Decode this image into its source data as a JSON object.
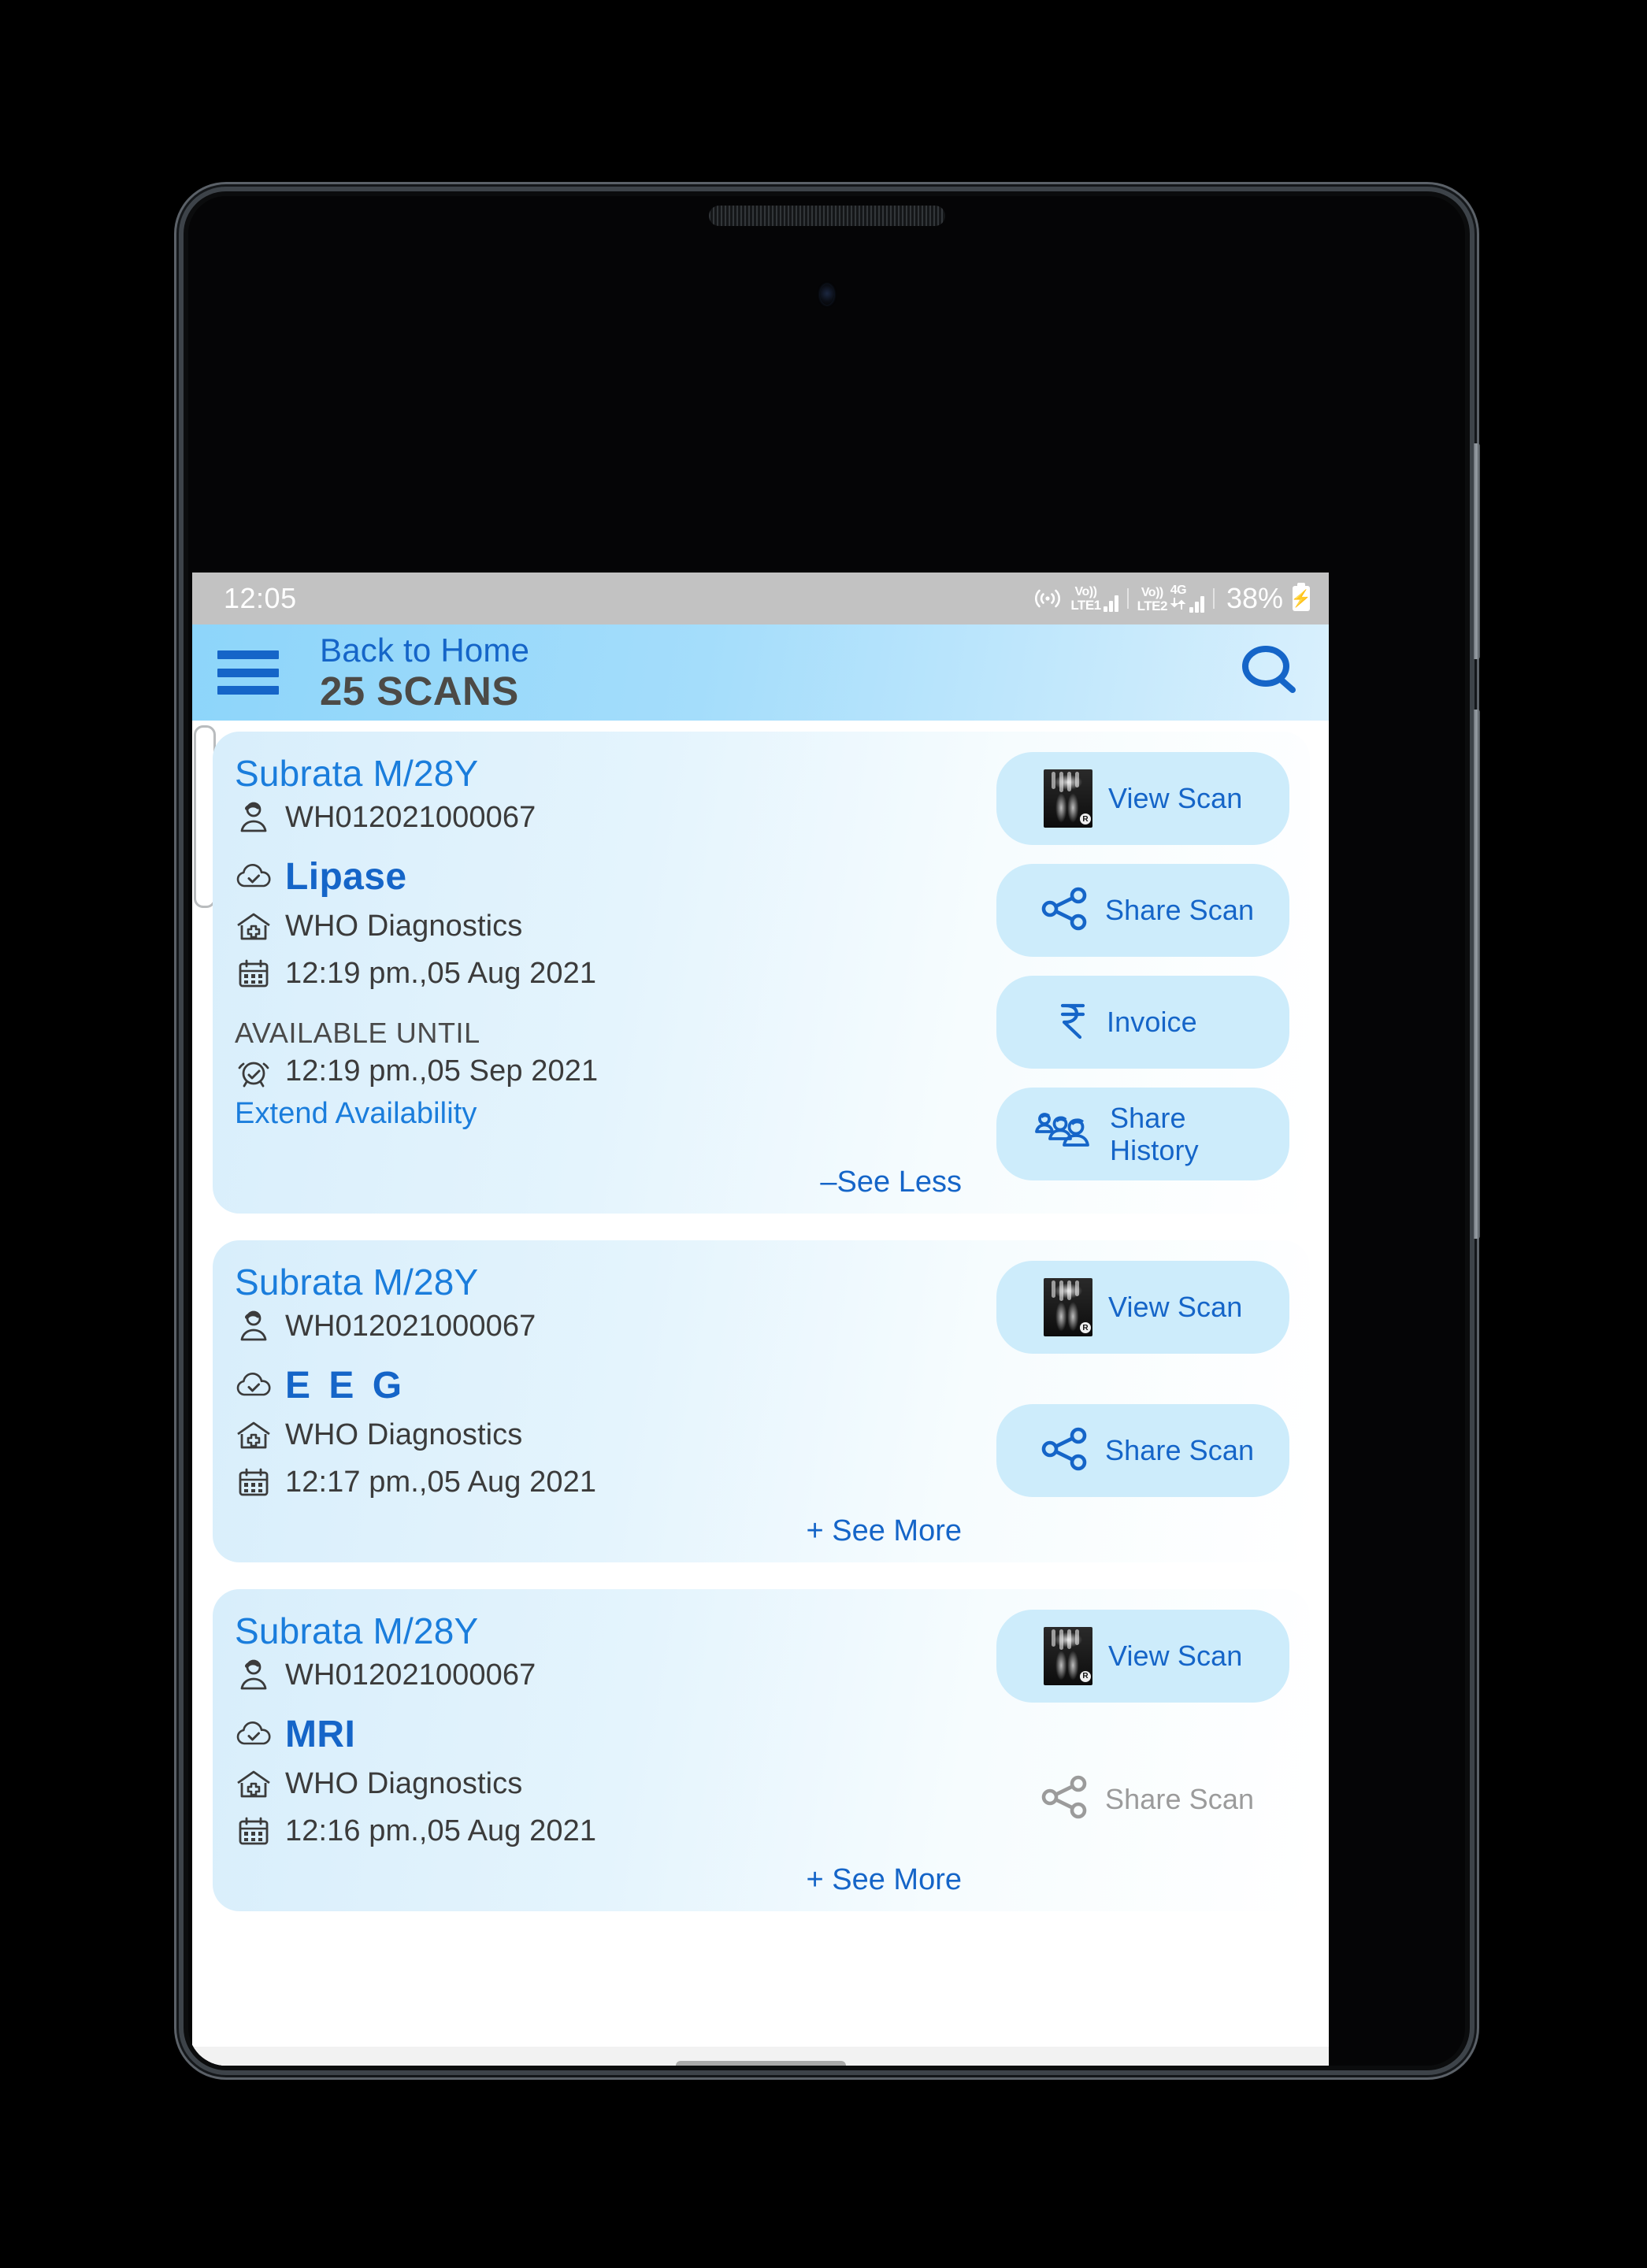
{
  "status_bar": {
    "time": "12:05",
    "hotspot_icon": "hotspot-icon",
    "sim1_volte": "Vo))",
    "sim1_label": "LTE1",
    "sim2_volte": "Vo))",
    "sim2_label": "LTE2",
    "network_type": "4G",
    "battery_percent": "38%",
    "battery_charging_icon": "battery-charging-icon"
  },
  "app_bar": {
    "menu_icon": "hamburger-menu-icon",
    "back_label": "Back to Home",
    "title": "25 SCANS",
    "search_icon": "search-icon",
    "accent_blue": "#1565c8",
    "title_gray": "#4c4a46",
    "bar_gradient_start": "#8dd5fa",
    "bar_gradient_end": "#d9f0fd"
  },
  "labels": {
    "available_until": "AVAILABLE UNTIL",
    "extend_availability": "Extend Availability",
    "see_less": "–See Less",
    "see_more": "+ See More",
    "view_scan": "View Scan",
    "share_scan": "Share Scan",
    "invoice": "Invoice",
    "share_history_line1": "Share",
    "share_history_line2": "History"
  },
  "cards": [
    {
      "patient": "Subrata M/28Y",
      "patient_id": "WH012021000067",
      "scan_name": "Lipase",
      "lab": "WHO Diagnostics",
      "datetime": "12:19 pm.,05 Aug 2021",
      "available_until_label": "AVAILABLE UNTIL",
      "available_until": "12:19 pm.,05 Sep 2021",
      "extend_label": "Extend Availability",
      "toggle": "–See Less",
      "expanded": true,
      "actions": [
        {
          "name": "view-scan",
          "label": "View Scan",
          "icon": "xray-thumbnail",
          "enabled": true
        },
        {
          "name": "share-scan",
          "label": "Share Scan",
          "icon": "share-nodes-icon",
          "enabled": true
        },
        {
          "name": "invoice",
          "label": "Invoice",
          "icon": "rupee-icon",
          "enabled": true
        },
        {
          "name": "share-history",
          "label": "Share History",
          "icon": "group-people-icon",
          "enabled": true
        }
      ]
    },
    {
      "patient": "Subrata M/28Y",
      "patient_id": "WH012021000067",
      "scan_name": "E E G",
      "lab": "WHO Diagnostics",
      "datetime": "12:17 pm.,05 Aug 2021",
      "toggle": "+ See More",
      "expanded": false,
      "actions": [
        {
          "name": "view-scan",
          "label": "View Scan",
          "icon": "xray-thumbnail",
          "enabled": true
        },
        {
          "name": "share-scan",
          "label": "Share Scan",
          "icon": "share-nodes-icon",
          "enabled": true
        }
      ]
    },
    {
      "patient": "Subrata M/28Y",
      "patient_id": "WH012021000067",
      "scan_name": "MRI",
      "lab": "WHO Diagnostics",
      "datetime": "12:16 pm.,05 Aug 2021",
      "toggle": "+ See More",
      "expanded": false,
      "actions": [
        {
          "name": "view-scan",
          "label": "View Scan",
          "icon": "xray-thumbnail",
          "enabled": true
        },
        {
          "name": "share-scan",
          "label": "Share Scan",
          "icon": "share-nodes-icon",
          "enabled": false
        }
      ]
    }
  ],
  "icons": {
    "patient_icon": "person-icon",
    "cloud_icon": "cloud-check-icon",
    "hospital_icon": "hospital-icon",
    "calendar_icon": "calendar-icon",
    "alarm_icon": "alarm-clock-icon"
  }
}
